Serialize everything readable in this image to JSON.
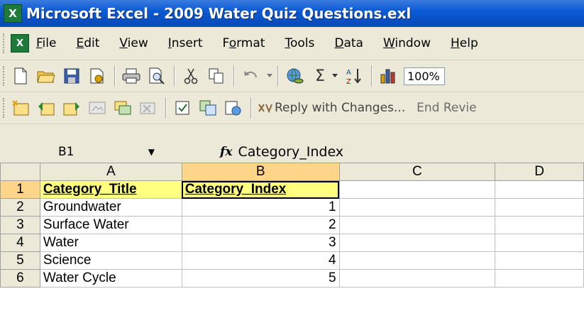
{
  "window": {
    "title": "Microsoft Excel - 2009 Water Quiz Questions.exl"
  },
  "menu": [
    {
      "u": "F",
      "rest": "ile"
    },
    {
      "u": "E",
      "rest": "dit"
    },
    {
      "u": "V",
      "rest": "iew"
    },
    {
      "u": "I",
      "rest": "nsert"
    },
    {
      "pre": "F",
      "u": "o",
      "rest": "rmat"
    },
    {
      "u": "T",
      "rest": "ools"
    },
    {
      "u": "D",
      "rest": "ata"
    },
    {
      "u": "W",
      "rest": "indow"
    },
    {
      "u": "H",
      "rest": "elp"
    }
  ],
  "toolbar": {
    "zoom": "100%",
    "sigma": "Σ",
    "reply_label": "Reply with Changes...",
    "end_review_label": "End Revie"
  },
  "formula_bar": {
    "cell_ref": "B1",
    "fx": "fx",
    "content": "Category_Index"
  },
  "sheet": {
    "columns": [
      "A",
      "B",
      "C",
      "D"
    ],
    "rows": [
      {
        "n": "1",
        "a": "Category_Title",
        "b": "Category_Index"
      },
      {
        "n": "2",
        "a": "Groundwater",
        "b": "1"
      },
      {
        "n": "3",
        "a": "Surface Water",
        "b": "2"
      },
      {
        "n": "4",
        "a": "Water",
        "b": "3"
      },
      {
        "n": "5",
        "a": "Science",
        "b": "4"
      },
      {
        "n": "6",
        "a": "Water Cycle",
        "b": "5"
      }
    ]
  }
}
